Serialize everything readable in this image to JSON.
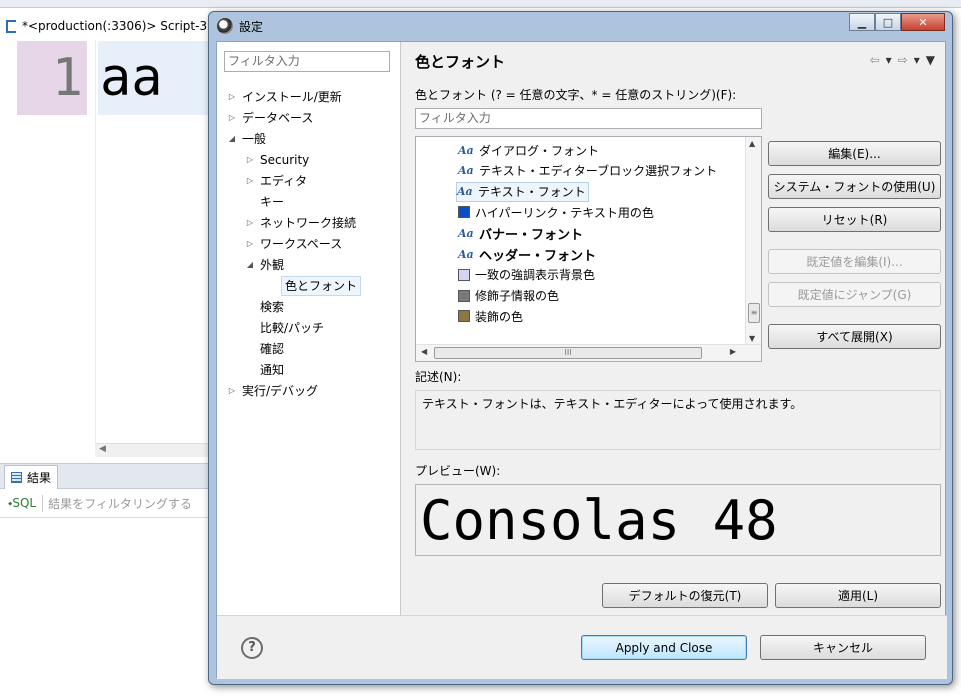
{
  "background": {
    "tab_title": "*<production(:3306)> Script-3",
    "gutter_number": "1",
    "editor_text": "aa",
    "hscroll_arrow": "◀",
    "results_tab": "結果",
    "sql_label": "SQL",
    "filter_placeholder": "結果をフィルタリングする"
  },
  "dialog": {
    "title": "設定",
    "window_buttons": {
      "minimize": "▁",
      "maximize": "□",
      "close": "✕"
    },
    "left_filter_placeholder": "フィルタ入力",
    "tree": [
      {
        "label": "インストール/更新",
        "twisty": "▷",
        "selected": false
      },
      {
        "label": "データベース",
        "twisty": "▷",
        "selected": false
      },
      {
        "label": "一般",
        "twisty": "◢",
        "selected": false
      },
      {
        "label": "Security",
        "twisty": "▷",
        "selected": false
      },
      {
        "label": "エディタ",
        "twisty": "▷",
        "selected": false
      },
      {
        "label": "キー",
        "twisty": "",
        "selected": false
      },
      {
        "label": "ネットワーク接続",
        "twisty": "▷",
        "selected": false
      },
      {
        "label": "ワークスペース",
        "twisty": "▷",
        "selected": false
      },
      {
        "label": "外観",
        "twisty": "◢",
        "selected": false
      },
      {
        "label": "色とフォント",
        "twisty": "",
        "selected": true
      },
      {
        "label": "検索",
        "twisty": "",
        "selected": false
      },
      {
        "label": "比較/パッチ",
        "twisty": "",
        "selected": false
      },
      {
        "label": "確認",
        "twisty": "",
        "selected": false
      },
      {
        "label": "通知",
        "twisty": "",
        "selected": false
      },
      {
        "label": "実行/デバッグ",
        "twisty": "▷",
        "selected": false
      }
    ],
    "page_title": "色とフォント",
    "nav": {
      "back": "⇦",
      "forward": "⇨",
      "dropdown": "▾",
      "menu": "▼"
    },
    "cf_label": "色とフォント (? = 任意の文字、* = 任意のストリング)(F):",
    "right_filter_placeholder": "フィルタ入力",
    "cf_items": [
      {
        "kind": "font",
        "label": "ダイアログ・フォント",
        "color": "",
        "bold": false,
        "selected": false
      },
      {
        "kind": "font",
        "label": "テキスト・エディターブロック選択フォント",
        "color": "",
        "bold": false,
        "selected": false
      },
      {
        "kind": "font",
        "label": "テキスト・フォント",
        "color": "",
        "bold": false,
        "selected": true
      },
      {
        "kind": "color",
        "label": "ハイパーリンク・テキスト用の色",
        "color": "#0a4fc7",
        "bold": false,
        "selected": false
      },
      {
        "kind": "font",
        "label": "バナー・フォント",
        "color": "",
        "bold": true,
        "selected": false
      },
      {
        "kind": "font",
        "label": "ヘッダー・フォント",
        "color": "",
        "bold": true,
        "selected": false
      },
      {
        "kind": "color",
        "label": "一致の強調表示背景色",
        "color": "#d4d4f5",
        "bold": false,
        "selected": false
      },
      {
        "kind": "color",
        "label": "修飾子情報の色",
        "color": "#7a7a7a",
        "bold": false,
        "selected": false
      },
      {
        "kind": "color",
        "label": "装飾の色",
        "color": "#8f7740",
        "bold": false,
        "selected": false
      }
    ],
    "font_icon_glyph": "Aa",
    "scroll": {
      "up": "▲",
      "down": "▼",
      "left": "◀",
      "right": "▶",
      "vthumb": "≡",
      "hthumb": "III"
    },
    "buttons": {
      "edit": "編集(E)...",
      "system_font": "システム・フォントの使用(U)",
      "reset": "リセット(R)",
      "edit_default": "既定値を編集(I)...",
      "goto_default": "既定値にジャンプ(G)",
      "expand_all": "すべて展開(X)",
      "restore_defaults": "デフォルトの復元(T)",
      "apply": "適用(L)",
      "apply_close": "Apply and Close",
      "cancel": "キャンセル"
    },
    "desc_label": "記述(N):",
    "description": "テキスト・フォントは、テキスト・エディターによって使用されます。",
    "preview_label": "プレビュー(W):",
    "preview_text": "Consolas 48",
    "help_glyph": "?"
  }
}
